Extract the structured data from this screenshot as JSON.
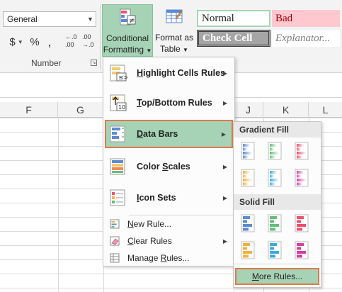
{
  "ribbon": {
    "number_format": "General",
    "currency_symbol": "$",
    "percent_symbol": "%",
    "comma_symbol": ",",
    "inc_decimal_top": "←.0",
    "inc_decimal_bottom": ".00",
    "dec_decimal_top": ".00",
    "dec_decimal_bottom": "→.0",
    "group_number_label": "Number",
    "conditional_formatting_line1": "Conditional",
    "conditional_formatting_line2": "Formatting",
    "format_as_table_line1": "Format as",
    "format_as_table_line2": "Table",
    "styles": {
      "normal": "Normal",
      "bad": "Bad",
      "check_cell": "Check Cell",
      "explanatory": "Explanator..."
    }
  },
  "sheet": {
    "columns": [
      "F",
      "G",
      "J",
      "K",
      "L"
    ]
  },
  "menu": {
    "highlight_pre": "",
    "highlight_u": "H",
    "highlight_post": "ighlight Cells Rules",
    "topbottom_pre": "",
    "topbottom_u": "T",
    "topbottom_post": "op/Bottom Rules",
    "databars_pre": "",
    "databars_u": "D",
    "databars_post": "ata Bars",
    "colorscales_pre": "Color ",
    "colorscales_u": "S",
    "colorscales_post": "cales",
    "iconsets_pre": "",
    "iconsets_u": "I",
    "iconsets_post": "con Sets",
    "newrule_pre": "",
    "newrule_u": "N",
    "newrule_post": "ew Rule...",
    "clearrules_pre": "",
    "clearrules_u": "C",
    "clearrules_post": "lear Rules",
    "managerules_pre": "Manage ",
    "managerules_u": "R",
    "managerules_post": "ules..."
  },
  "submenu": {
    "gradient_fill": "Gradient Fill",
    "solid_fill": "Solid Fill",
    "more_rules_pre": "",
    "more_rules_u": "M",
    "more_rules_post": "ore Rules..."
  },
  "colors": {
    "accent_green": "#a6d3b5",
    "highlight_border": "#e07a49",
    "bar_blue": "#5b8bd0",
    "bar_green": "#63be7b",
    "bar_red": "#f04f6e",
    "bar_orange": "#f5b041",
    "bar_lightblue": "#3fa8e0",
    "bar_purple": "#d63fa0"
  }
}
